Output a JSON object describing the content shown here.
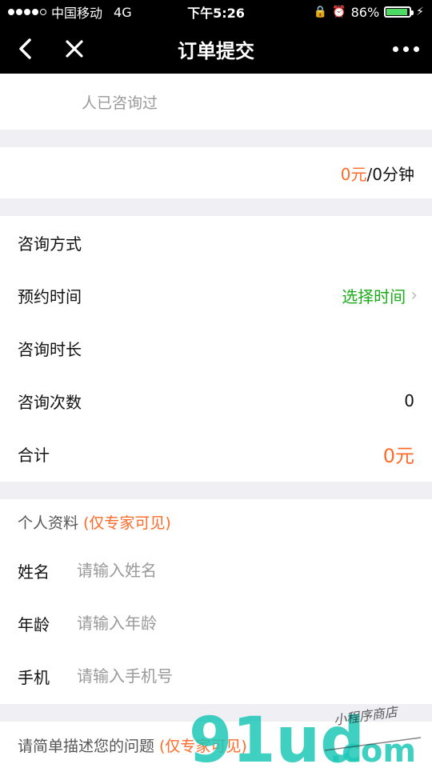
{
  "status_bar": {
    "carrier": "中国移动",
    "network": "4G",
    "time": "下午5:26",
    "battery": "86%",
    "battery_level": 0.86
  },
  "nav": {
    "title": "订单提交",
    "back_icon": "chevron-left-icon",
    "close_icon": "close-icon",
    "more_icon": "more-icon"
  },
  "consulted": {
    "text": "人已咨询过"
  },
  "price": {
    "amount": "0元",
    "per": "/0分钟"
  },
  "consult_info": {
    "method_label": "咨询方式",
    "appointment_label": "预约时间",
    "appointment_action": "选择时间",
    "duration_label": "咨询时长",
    "count_label": "咨询次数",
    "count_value": "0",
    "total_label": "合计",
    "total_value": "0元"
  },
  "profile": {
    "title": "个人资料",
    "title_note": "(仅专家可见)",
    "name_label": "姓名",
    "name_placeholder": "请输入姓名",
    "age_label": "年龄",
    "age_placeholder": "请输入年龄",
    "phone_label": "手机",
    "phone_placeholder": "请输入手机号"
  },
  "describe": {
    "text": "请简单描述您的问题",
    "note": "(仅专家可见)"
  },
  "watermark": {
    "brand": "91ud",
    "tld": ".com",
    "tagline": "小程序商店"
  },
  "colors": {
    "accent_orange": "#ff6a28",
    "accent_green": "#1aad19",
    "nav_bg": "#000000",
    "page_bg": "#efeff4"
  }
}
